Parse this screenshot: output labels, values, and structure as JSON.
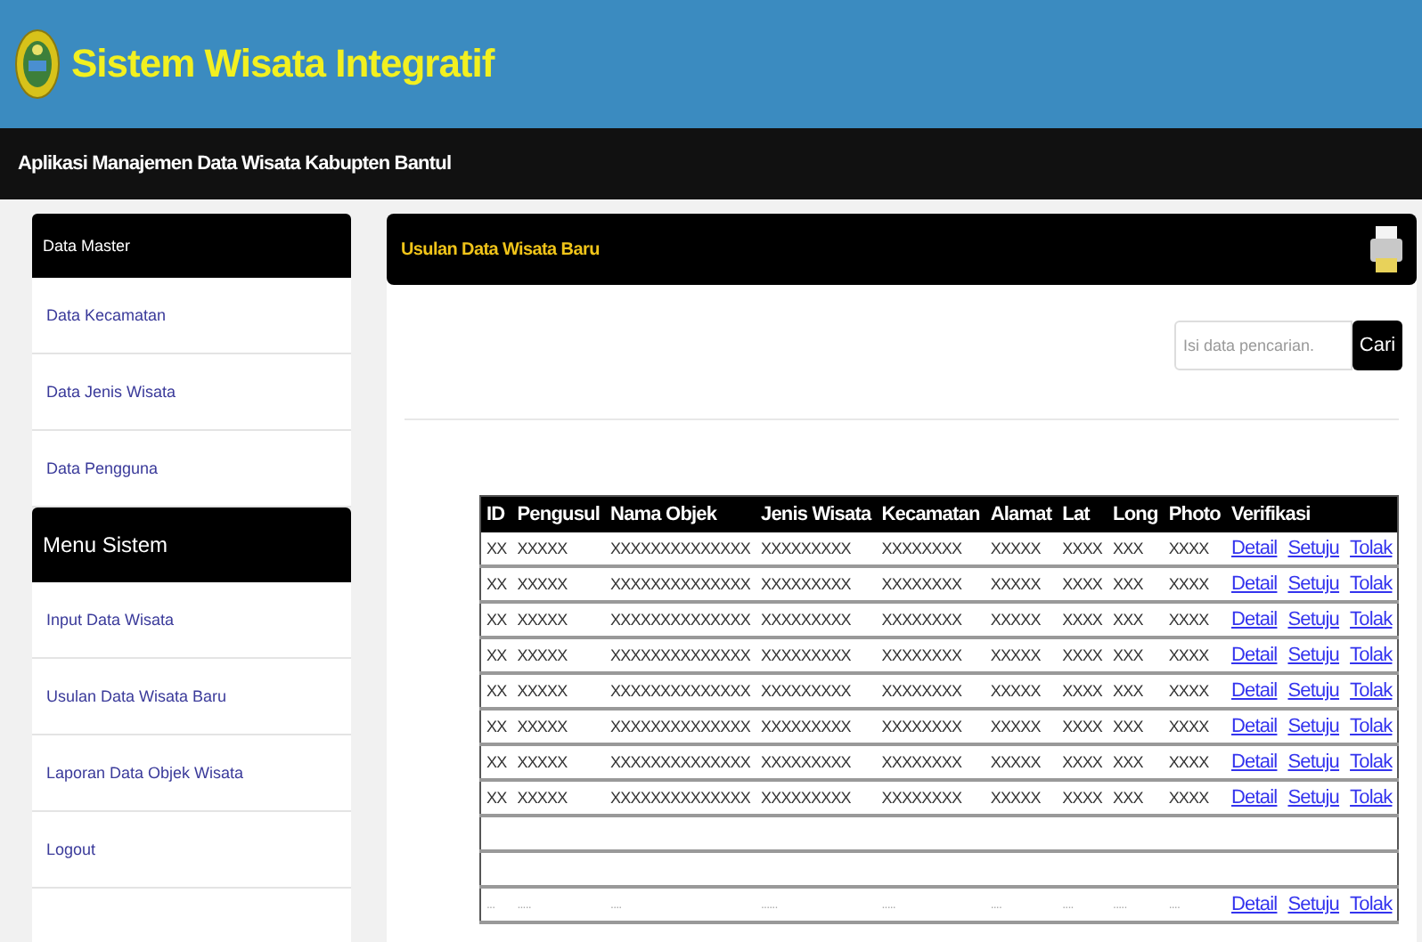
{
  "header": {
    "title": "Sistem Wisata Integratif",
    "subtitle": "Aplikasi Manajemen Data Wisata Kabupten Bantul"
  },
  "sidebar": {
    "sections": [
      {
        "title": "Data Master",
        "kind": "group",
        "items": [
          "Data Kecamatan",
          "Data Jenis Wisata",
          "Data Pengguna"
        ]
      },
      {
        "title": "Menu Sistem",
        "kind": "menu",
        "items": [
          "Input Data Wisata",
          "Usulan Data Wisata Baru",
          "Laporan Data Objek Wisata",
          "Logout"
        ]
      }
    ]
  },
  "panel": {
    "title": "Usulan Data Wisata Baru",
    "search": {
      "placeholder": "Isi data pencarian.",
      "button": "Cari"
    }
  },
  "table": {
    "columns": [
      "ID",
      "Pengusul",
      "Nama Objek",
      "Jenis Wisata",
      "Kecamatan",
      "Alamat",
      "Lat",
      "Long",
      "Photo",
      "Verifikasi"
    ],
    "rows": [
      {
        "kind": "data",
        "cells": [
          "XX",
          "XXXXX",
          "XXXXXXXXXXXXXX",
          "XXXXXXXXX",
          "XXXXXXXX",
          "XXXXX",
          "XXXX",
          "XXX",
          "XXXX"
        ],
        "actions": [
          "Detail",
          "Setuju",
          "Tolak"
        ]
      },
      {
        "kind": "data",
        "cells": [
          "XX",
          "XXXXX",
          "XXXXXXXXXXXXXX",
          "XXXXXXXXX",
          "XXXXXXXX",
          "XXXXX",
          "XXXX",
          "XXX",
          "XXXX"
        ],
        "actions": [
          "Detail",
          "Setuju",
          "Tolak"
        ]
      },
      {
        "kind": "data",
        "cells": [
          "XX",
          "XXXXX",
          "XXXXXXXXXXXXXX",
          "XXXXXXXXX",
          "XXXXXXXX",
          "XXXXX",
          "XXXX",
          "XXX",
          "XXXX"
        ],
        "actions": [
          "Detail",
          "Setuju",
          "Tolak"
        ]
      },
      {
        "kind": "data",
        "cells": [
          "XX",
          "XXXXX",
          "XXXXXXXXXXXXXX",
          "XXXXXXXXX",
          "XXXXXXXX",
          "XXXXX",
          "XXXX",
          "XXX",
          "XXXX"
        ],
        "actions": [
          "Detail",
          "Setuju",
          "Tolak"
        ]
      },
      {
        "kind": "data",
        "cells": [
          "XX",
          "XXXXX",
          "XXXXXXXXXXXXXX",
          "XXXXXXXXX",
          "XXXXXXXX",
          "XXXXX",
          "XXXX",
          "XXX",
          "XXXX"
        ],
        "actions": [
          "Detail",
          "Setuju",
          "Tolak"
        ]
      },
      {
        "kind": "data",
        "cells": [
          "XX",
          "XXXXX",
          "XXXXXXXXXXXXXX",
          "XXXXXXXXX",
          "XXXXXXXX",
          "XXXXX",
          "XXXX",
          "XXX",
          "XXXX"
        ],
        "actions": [
          "Detail",
          "Setuju",
          "Tolak"
        ]
      },
      {
        "kind": "data",
        "cells": [
          "XX",
          "XXXXX",
          "XXXXXXXXXXXXXX",
          "XXXXXXXXX",
          "XXXXXXXX",
          "XXXXX",
          "XXXX",
          "XXX",
          "XXXX"
        ],
        "actions": [
          "Detail",
          "Setuju",
          "Tolak"
        ]
      },
      {
        "kind": "data",
        "cells": [
          "XX",
          "XXXXX",
          "XXXXXXXXXXXXXX",
          "XXXXXXXXX",
          "XXXXXXXX",
          "XXXXX",
          "XXXX",
          "XXX",
          "XXXX"
        ],
        "actions": [
          "Detail",
          "Setuju",
          "Tolak"
        ]
      },
      {
        "kind": "empty"
      },
      {
        "kind": "empty"
      },
      {
        "kind": "faint",
        "cells": [
          "...",
          ".....",
          "....",
          "......",
          ".....",
          "....",
          "....",
          ".....",
          "...."
        ],
        "actions": [
          "Detail",
          "Setuju",
          "Tolak"
        ]
      }
    ]
  }
}
